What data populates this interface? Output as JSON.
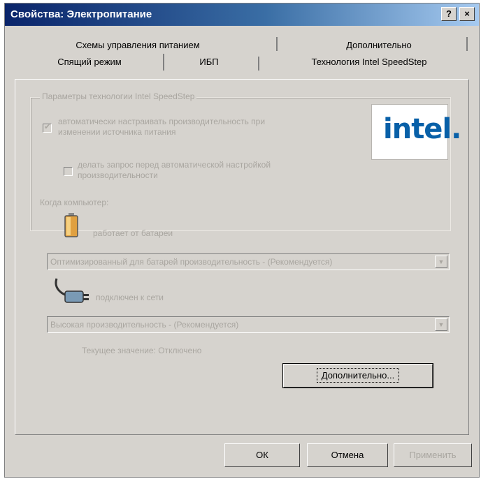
{
  "window": {
    "title": "Свойства: Электропитание",
    "help_label": "?",
    "close_label": "×"
  },
  "tabs": {
    "row1": [
      "Схемы управления питанием",
      "Дополнительно"
    ],
    "row2": [
      "Спящий режим",
      "ИБП",
      "Технология Intel SpeedStep"
    ],
    "active": "Технология Intel SpeedStep"
  },
  "speedstep": {
    "group_title": "Параметры технологии Intel SpeedStep",
    "auto_adjust_label": "автоматически настраивать производительность при изменении источника питания",
    "auto_adjust_checked": true,
    "ask_before_label": "делать запрос перед автоматической настройкой производительности",
    "ask_before_checked": false,
    "logo_text": "intel.",
    "when_computer_label": "Когда компьютер:",
    "battery_label": "работает от батареи",
    "battery_policy": "Оптимизированный для батарей производительность - (Рекомендуется)",
    "ac_label": "подключен к сети",
    "ac_policy": "Высокая производительность - (Рекомендуется)",
    "current_state": "Текущее значение: Отключено",
    "advanced_button": "Дополнительно..."
  },
  "footer": {
    "ok": "ОК",
    "cancel": "Отмена",
    "apply": "Применить"
  },
  "colors": {
    "dialog_bg": "#d6d3ce",
    "title_start": "#0a246a",
    "title_end": "#a6caf0",
    "disabled_text": "#a9a6a0",
    "intel_blue": "#0860a8"
  }
}
